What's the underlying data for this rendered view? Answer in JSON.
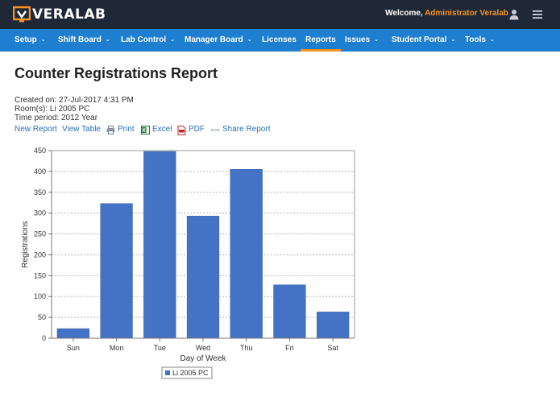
{
  "app": {
    "logo_text": "VERALAB",
    "welcome_prefix": "Welcome, ",
    "welcome_user": "Administrator Veralab"
  },
  "nav": [
    {
      "label": "Setup",
      "dropdown": true
    },
    {
      "label": "Shift Board",
      "dropdown": true
    },
    {
      "label": "Lab Control",
      "dropdown": true
    },
    {
      "label": "Manager Board",
      "dropdown": true
    },
    {
      "label": "Licenses",
      "dropdown": false
    },
    {
      "label": "Reports",
      "dropdown": false,
      "active": true
    },
    {
      "label": "Issues",
      "dropdown": true
    },
    {
      "label": "Student Portal",
      "dropdown": true
    },
    {
      "label": "Tools",
      "dropdown": true
    }
  ],
  "report": {
    "title": "Counter Registrations Report",
    "created": "Created on: 27-Jul-2017 4:31 PM",
    "rooms": "Room(s): Li 2005 PC",
    "period": "Time period: 2012 Year"
  },
  "actions": {
    "new_report": "New Report",
    "view_table": "View Table",
    "print": "Print",
    "excel": "Excel",
    "pdf": "PDF",
    "share": "Share Report"
  },
  "icons": {
    "logo": "monitor-logo-icon",
    "user": "user-icon",
    "menu": "hamburger-menu-icon",
    "print": "printer-icon",
    "excel": "excel-icon",
    "pdf": "pdf-icon",
    "share": "share-icon"
  },
  "colors": {
    "topbar": "#1f2837",
    "navbar": "#1e7ecf",
    "accent": "#f7941d",
    "bar": "#4472c4",
    "link": "#2a6fb8"
  },
  "chart_data": {
    "type": "bar",
    "categories": [
      "Sun",
      "Mon",
      "Tue",
      "Wed",
      "Thu",
      "Fri",
      "Sat"
    ],
    "series": [
      {
        "name": "Li 2005 PC",
        "values": [
          23,
          323,
          448,
          293,
          405,
          128,
          63
        ]
      }
    ],
    "xlabel": "Day of Week",
    "ylabel": "Registrations",
    "ylim": [
      0,
      450
    ],
    "yticks": [
      0,
      50,
      100,
      150,
      200,
      250,
      300,
      350,
      400,
      450
    ],
    "grid": true,
    "legend": "bottom-center"
  }
}
